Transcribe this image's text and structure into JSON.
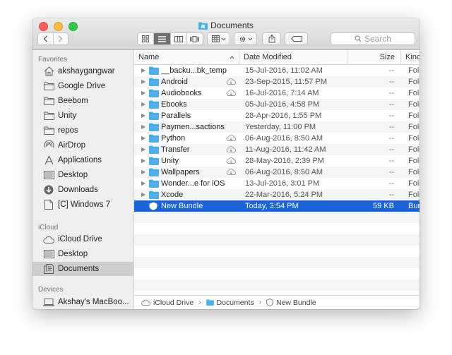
{
  "window": {
    "title": "Documents"
  },
  "toolbar": {
    "search_placeholder": "Search"
  },
  "sidebar": {
    "favorites_header": "Favorites",
    "favorites": [
      {
        "label": "akshaygangwar",
        "icon": "home-icon"
      },
      {
        "label": "Google Drive",
        "icon": "folder-icon"
      },
      {
        "label": "Beebom",
        "icon": "folder-icon"
      },
      {
        "label": "Unity",
        "icon": "folder-icon"
      },
      {
        "label": "repos",
        "icon": "folder-icon"
      },
      {
        "label": "AirDrop",
        "icon": "airdrop-icon"
      },
      {
        "label": "Applications",
        "icon": "applications-icon"
      },
      {
        "label": "Desktop",
        "icon": "desktop-icon"
      },
      {
        "label": "Downloads",
        "icon": "downloads-icon"
      },
      {
        "label": "[C] Windows 7",
        "icon": "document-icon"
      }
    ],
    "icloud_header": "iCloud",
    "icloud": [
      {
        "label": "iCloud Drive",
        "icon": "cloud-icon"
      },
      {
        "label": "Desktop",
        "icon": "desktop-icon"
      },
      {
        "label": "Documents",
        "icon": "documents-icon",
        "selected": true
      }
    ],
    "devices_header": "Devices",
    "devices": [
      {
        "label": "Akshay's MacBoo...",
        "icon": "laptop-icon"
      }
    ]
  },
  "columns": {
    "name": "Name",
    "date": "Date Modified",
    "size": "Size",
    "kind": "Kind"
  },
  "files": [
    {
      "name": "__backu...bk_temp",
      "date": "15-Jul-2016, 11:02 AM",
      "size": "--",
      "kind": "Folder",
      "cloud": false
    },
    {
      "name": "Android",
      "date": "23-Sep-2015, 11:57 PM",
      "size": "--",
      "kind": "Folder",
      "cloud": true
    },
    {
      "name": "Audiobooks",
      "date": "16-Jul-2016, 7:14 AM",
      "size": "--",
      "kind": "Folder",
      "cloud": true
    },
    {
      "name": "Ebooks",
      "date": "05-Jul-2016, 4:58 PM",
      "size": "--",
      "kind": "Folder",
      "cloud": false
    },
    {
      "name": "Parallels",
      "date": "28-Apr-2016, 1:55 PM",
      "size": "--",
      "kind": "Folder",
      "cloud": false
    },
    {
      "name": "Paymen...sactions",
      "date": "Yesterday, 11:00 PM",
      "size": "--",
      "kind": "Folder",
      "cloud": false
    },
    {
      "name": "Python",
      "date": "06-Aug-2016, 8:50 AM",
      "size": "--",
      "kind": "Folder",
      "cloud": true
    },
    {
      "name": "Transfer",
      "date": "11-Aug-2016, 11:42 AM",
      "size": "--",
      "kind": "Folder",
      "cloud": true
    },
    {
      "name": "Unity",
      "date": "28-May-2016, 2:39 PM",
      "size": "--",
      "kind": "Folder",
      "cloud": true
    },
    {
      "name": "Wallpapers",
      "date": "06-Aug-2016, 8:50 AM",
      "size": "--",
      "kind": "Folder",
      "cloud": true
    },
    {
      "name": "Wonder...e for iOS",
      "date": "13-Jul-2016, 3:01 PM",
      "size": "--",
      "kind": "Folder",
      "cloud": false
    },
    {
      "name": "Xcode",
      "date": "22-Mar-2016, 5:24 PM",
      "size": "--",
      "kind": "Folder",
      "cloud": false
    },
    {
      "name": "New Bundle",
      "date": "Today, 3:54 PM",
      "size": "59 KB",
      "kind": "Bundle",
      "cloud": false,
      "selected": true,
      "bundle": true
    }
  ],
  "pathbar": [
    "iCloud Drive",
    "Documents",
    "New Bundle"
  ],
  "colors": {
    "selection": "#1a63d8",
    "folder": "#4bb1ea",
    "close": "#fc605c",
    "minimize": "#fdbc40",
    "zoom": "#34c84a"
  }
}
